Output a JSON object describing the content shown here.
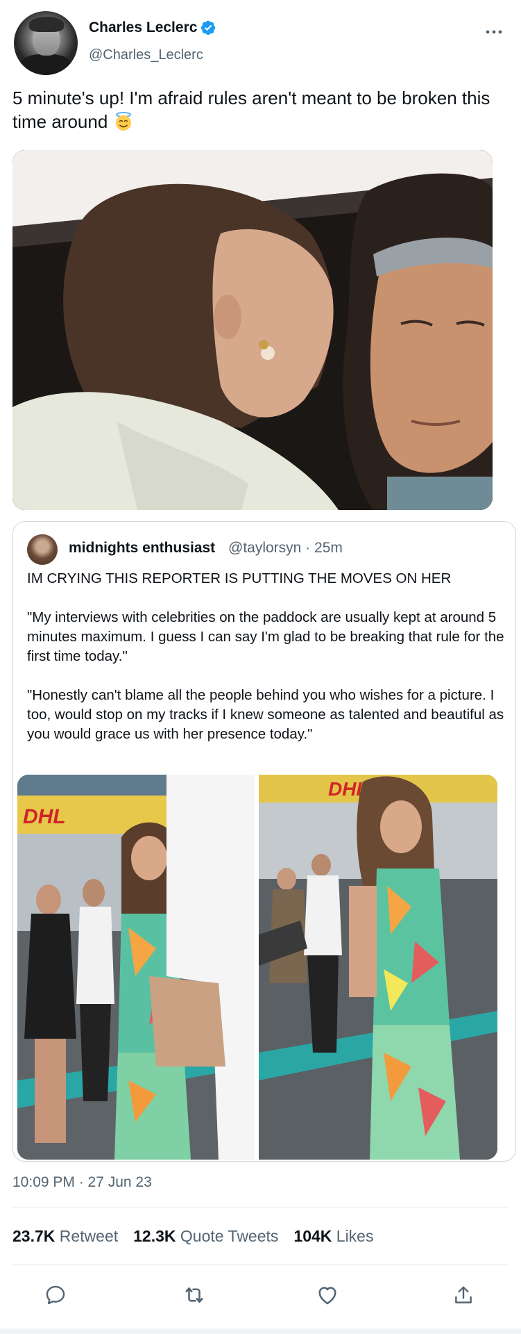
{
  "author": {
    "display_name": "Charles Leclerc",
    "handle": "@Charles_Leclerc",
    "verified_icon": "verified-badge-icon",
    "more_icon": "more-options-icon"
  },
  "tweet": {
    "text": "5 minute's up! I'm afraid rules aren't meant to be broken this time around",
    "emoji": "smiling-face-with-halo-icon",
    "timestamp": "10:09 PM · 27 Jun 23"
  },
  "quote": {
    "display_name": "midnights enthusiast",
    "handle_and_time": "@taylorsyn · 25m",
    "text": "IM CRYING THIS REPORTER IS PUTTING THE MOVES ON HER\n\n\"My interviews with celebrities on the paddock are usually kept at around 5 minutes maximum. I guess I can say I'm glad to be breaking that rule for the first time today.\"\n\n\"Honestly can't blame all the people behind you who wishes for a picture. I too, would stop on my tracks if I knew someone as talented and beautiful as you would grace us with her presence today.\""
  },
  "stats": {
    "retweets": "23.7K",
    "retweets_label": "Retweet",
    "quotes": "12.3K",
    "quotes_label": "Quote Tweets",
    "likes": "104K",
    "likes_label": "Likes"
  },
  "actions": {
    "reply_icon": "reply-icon",
    "retweet_icon": "retweet-icon",
    "like_icon": "like-icon",
    "share_icon": "share-icon"
  },
  "colors": {
    "verified": "#1d9bf0",
    "secondary_text": "#536471",
    "border": "#cfd9de"
  }
}
